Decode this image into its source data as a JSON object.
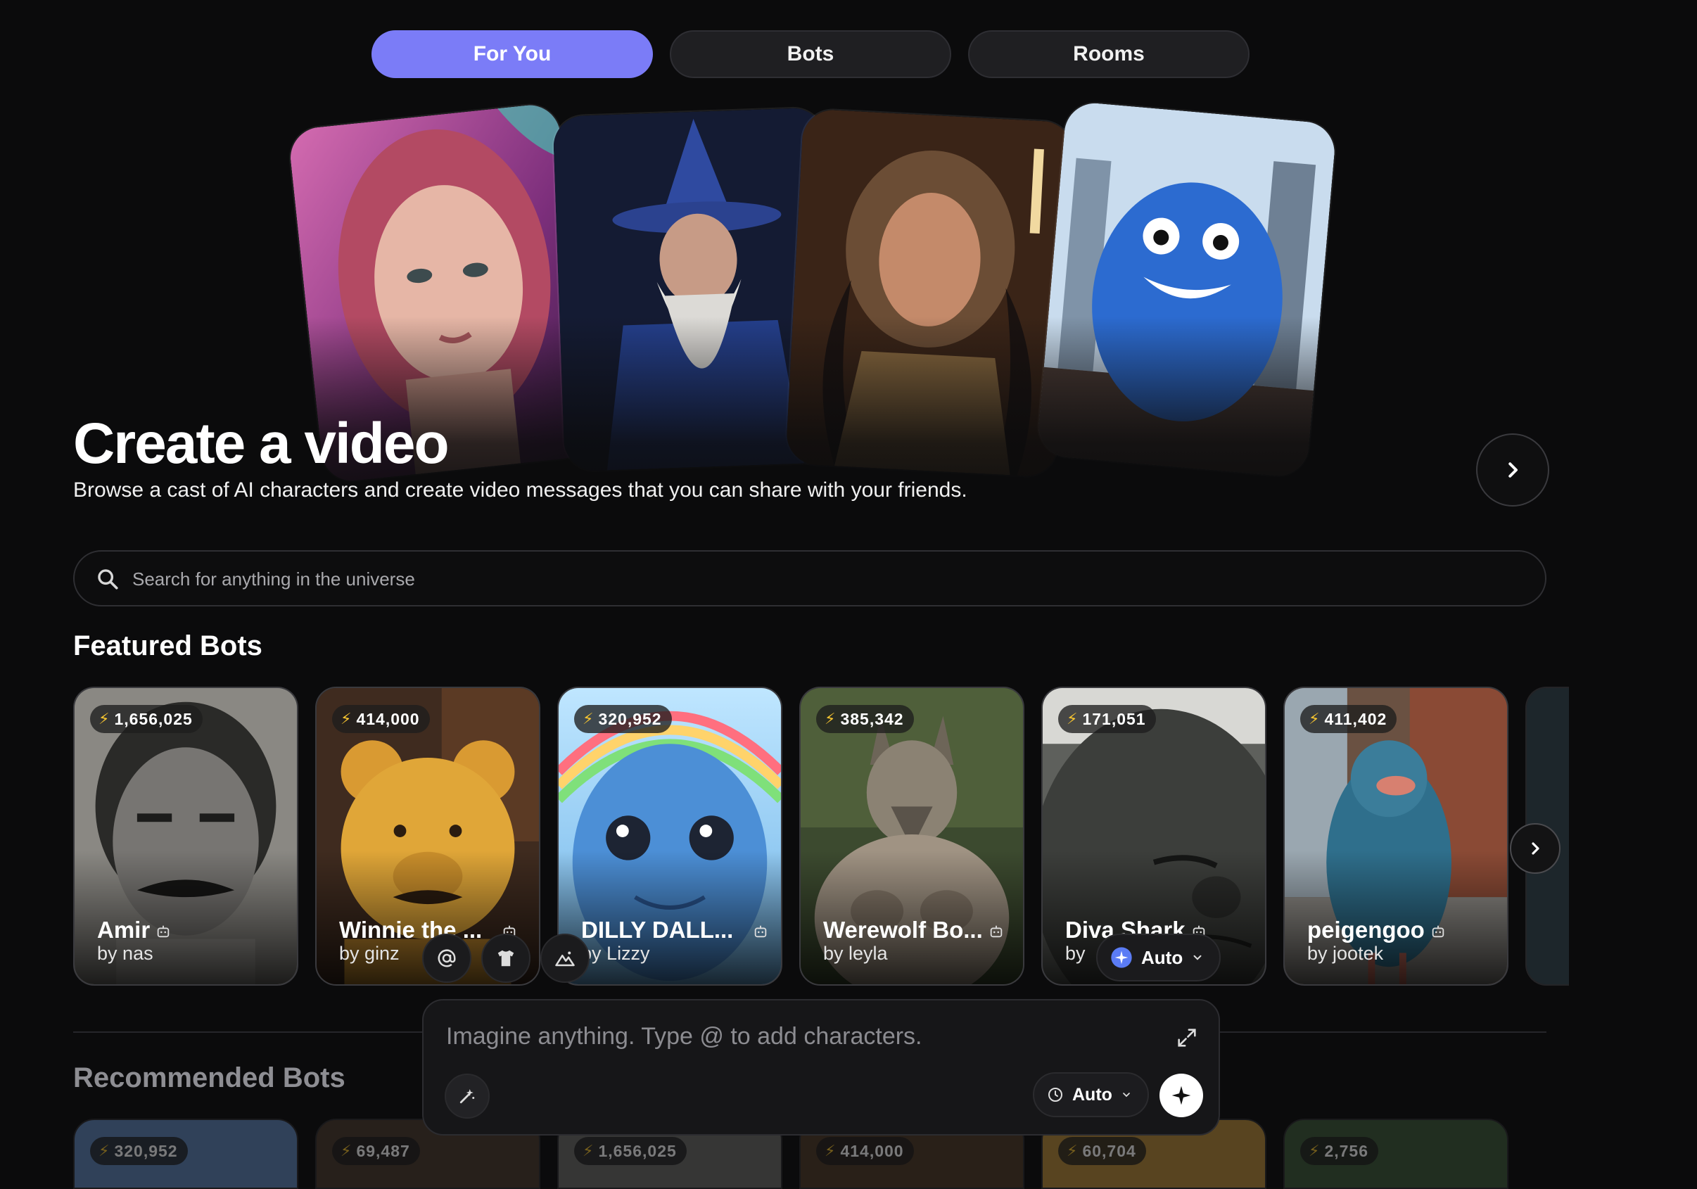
{
  "tabs": [
    {
      "label": "For You",
      "active": true
    },
    {
      "label": "Bots",
      "active": false
    },
    {
      "label": "Rooms",
      "active": false
    }
  ],
  "hero": {
    "title": "Create a video",
    "subtitle": "Browse a cast of AI characters and create video messages that you can share with your friends.",
    "next_icon": "chevron-right-icon"
  },
  "search": {
    "placeholder": "Search for anything in the universe",
    "icon": "search-icon"
  },
  "featured": {
    "title": "Featured Bots",
    "bots": [
      {
        "count": "1,656,025",
        "name": "Amir",
        "by": "by",
        "author": "nas"
      },
      {
        "count": "414,000",
        "name": "Winnie the ...",
        "by": "by",
        "author": "ginz"
      },
      {
        "count": "320,952",
        "name": "DILLY DALL...",
        "by": "by",
        "author": "Lizzy"
      },
      {
        "count": "385,342",
        "name": "Werewolf Bo...",
        "by": "by",
        "author": "leyla"
      },
      {
        "count": "171,051",
        "name": "Diva Shark",
        "by": "by",
        "author": ""
      },
      {
        "count": "411,402",
        "name": "peigengoo",
        "by": "by",
        "author": "jootek"
      }
    ]
  },
  "recommended": {
    "title": "Recommended Bots",
    "counts": [
      "320,952",
      "69,487",
      "1,656,025",
      "414,000",
      "60,704",
      "2,756"
    ]
  },
  "composer": {
    "placeholder": "Imagine anything. Type @ to add characters.",
    "mode_label": "Auto",
    "model_label": "Auto"
  },
  "colors": {
    "accent": "#7b7cf7",
    "background": "#0b0b0c",
    "bolt": "#f8c530"
  }
}
